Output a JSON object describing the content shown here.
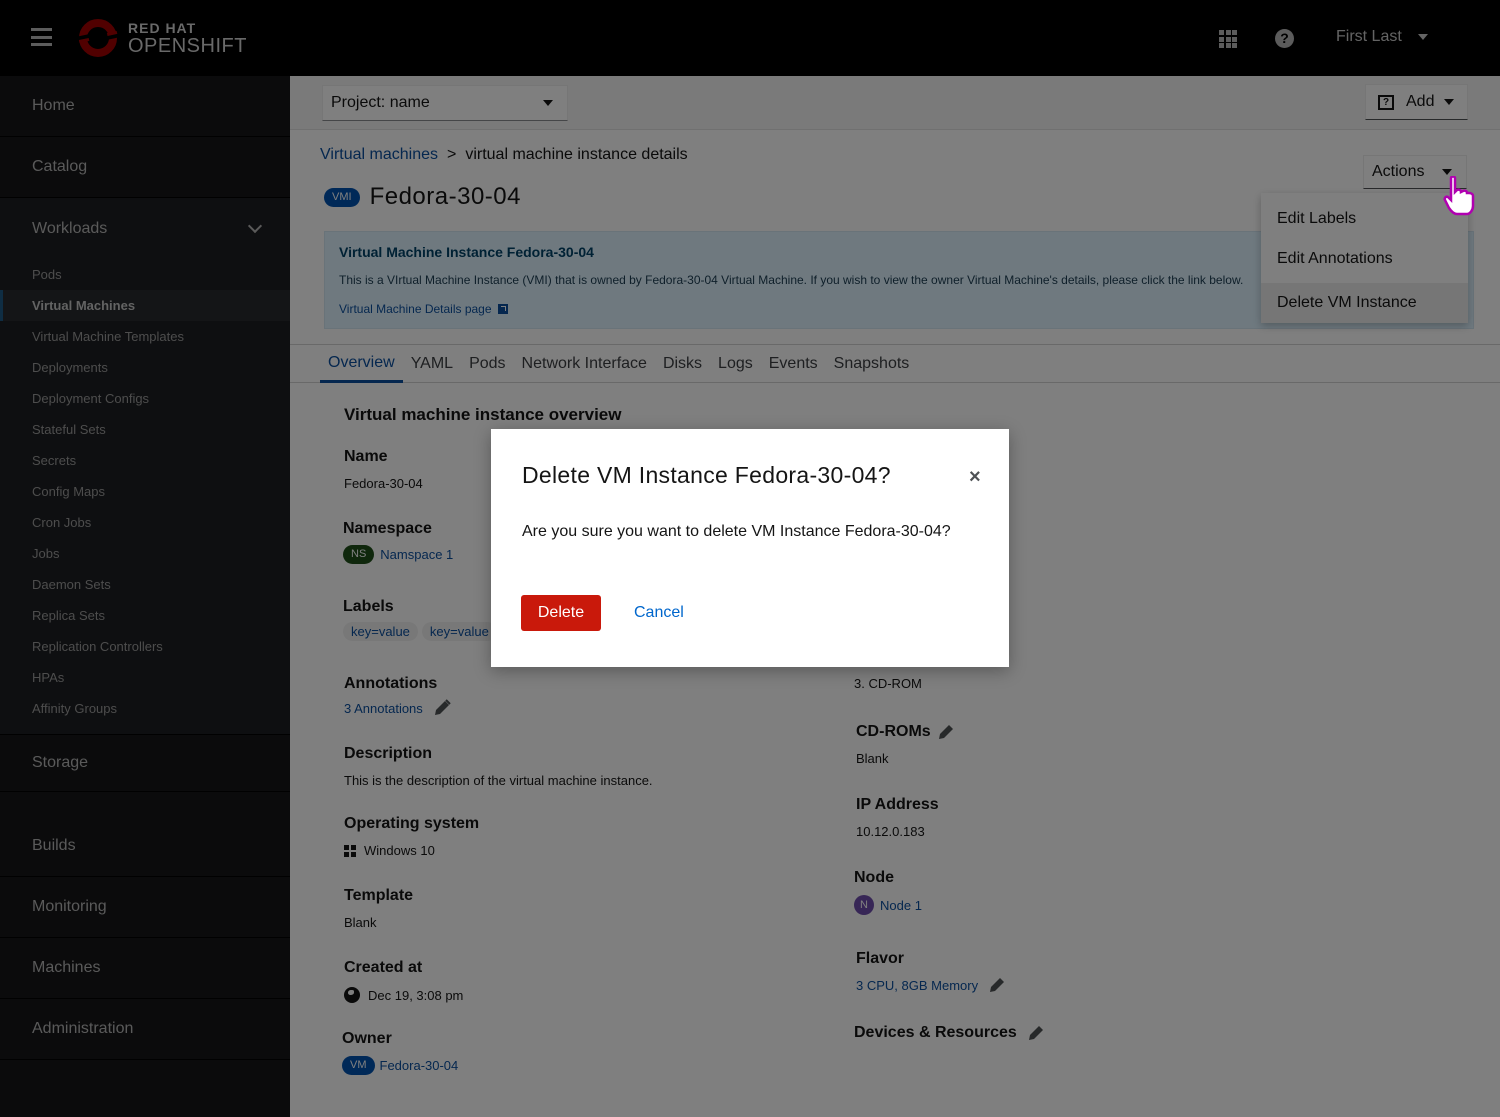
{
  "masthead": {
    "brand_top": "RED HAT",
    "brand_bottom": "OPENSHIFT",
    "user_name": "First Last",
    "icons": {
      "menu": "hamburger-icon",
      "apps": "app-launcher-icon",
      "help": "help-icon",
      "user_caret": "caret-down-icon"
    }
  },
  "sidebar": {
    "top_items": [
      {
        "label": "Home"
      },
      {
        "label": "Catalog"
      }
    ],
    "workloads": {
      "label": "Workloads",
      "expanded": true,
      "items": [
        {
          "label": "Pods",
          "active": false
        },
        {
          "label": "Virtual Machines",
          "active": true
        },
        {
          "label": "Virtual Machine Templates",
          "active": false
        },
        {
          "label": "Deployments",
          "active": false
        },
        {
          "label": "Deployment Configs",
          "active": false
        },
        {
          "label": "Stateful Sets",
          "active": false
        },
        {
          "label": "Secrets",
          "active": false
        },
        {
          "label": "Config Maps",
          "active": false
        },
        {
          "label": "Cron Jobs",
          "active": false
        },
        {
          "label": "Jobs",
          "active": false
        },
        {
          "label": "Daemon Sets",
          "active": false
        },
        {
          "label": "Replica Sets",
          "active": false
        },
        {
          "label": "Replication Controllers",
          "active": false
        },
        {
          "label": "HPAs",
          "active": false
        },
        {
          "label": "Affinity Groups",
          "active": false
        }
      ]
    },
    "bottom_items": [
      {
        "label": "Storage"
      },
      {
        "label": "Builds"
      },
      {
        "label": "Monitoring"
      },
      {
        "label": "Machines"
      },
      {
        "label": "Administration"
      }
    ]
  },
  "toolbar": {
    "project_select": "Project: name",
    "add_label": "Add"
  },
  "breadcrumb": {
    "parent": "Virtual machines",
    "separator": ">",
    "current": "virtual machine instance details"
  },
  "header": {
    "badge": "VMI",
    "title": "Fedora-30-04",
    "actions_label": "Actions"
  },
  "actions_menu": {
    "items": [
      {
        "label": "Edit Labels"
      },
      {
        "label": "Edit Annotations"
      },
      {
        "label": "Delete VM Instance",
        "hovered": true
      }
    ]
  },
  "alert": {
    "title": "Virtual Machine Instance Fedora-30-04",
    "body": "This is a VIrtual Machine Instance (VMI) that is owned by Fedora-30-04 Virtual Machine. If you wish to view the owner Virtual Machine's details, please click the link below.",
    "link": "Virtual Machine Details page"
  },
  "tabs": [
    {
      "label": "Overview",
      "active": true
    },
    {
      "label": "YAML",
      "active": false
    },
    {
      "label": "Pods",
      "active": false
    },
    {
      "label": "Network Interface",
      "active": false
    },
    {
      "label": "Disks",
      "active": false
    },
    {
      "label": "Logs",
      "active": false
    },
    {
      "label": "Events",
      "active": false
    },
    {
      "label": "Snapshots",
      "active": false
    }
  ],
  "overview": {
    "section_title": "Virtual machine instance overview",
    "left": {
      "name": {
        "label": "Name",
        "value": "Fedora-30-04"
      },
      "namespace": {
        "label": "Namespace",
        "badge": "NS",
        "value": "Namspace 1"
      },
      "labels": {
        "label": "Labels",
        "chips": [
          "key=value",
          "key=value"
        ]
      },
      "annotations": {
        "label": "Annotations",
        "value": "3 Annotations"
      },
      "description": {
        "label": "Description",
        "value": "This is the description of the virtual machine instance."
      },
      "os": {
        "label": "Operating system",
        "value": "Windows 10"
      },
      "template": {
        "label": "Template",
        "value": "Blank"
      },
      "created": {
        "label": "Created at",
        "value": "Dec 19, 3:08 pm"
      },
      "owner": {
        "label": "Owner",
        "badge": "VM",
        "value": "Fedora-30-04"
      }
    },
    "right": {
      "boot_order_last": "3. CD-ROM",
      "cdroms": {
        "label": "CD-ROMs",
        "value": "Blank"
      },
      "ip": {
        "label": "IP Address",
        "value": "10.12.0.183"
      },
      "node": {
        "label": "Node",
        "badge": "N",
        "value": "Node 1"
      },
      "flavor": {
        "label": "Flavor",
        "value": "3 CPU, 8GB Memory"
      },
      "devices": {
        "label": "Devices & Resources"
      }
    }
  },
  "modal": {
    "title": "Delete VM Instance Fedora-30-04?",
    "body": "Are you sure you want to delete VM Instance Fedora-30-04?",
    "confirm_label": "Delete",
    "cancel_label": "Cancel",
    "close_glyph": "×"
  },
  "colors": {
    "danger": "#c9190b",
    "link": "#0066cc",
    "brand_red": "#a30000",
    "overlay": "rgba(0,0,0,0.5)"
  }
}
